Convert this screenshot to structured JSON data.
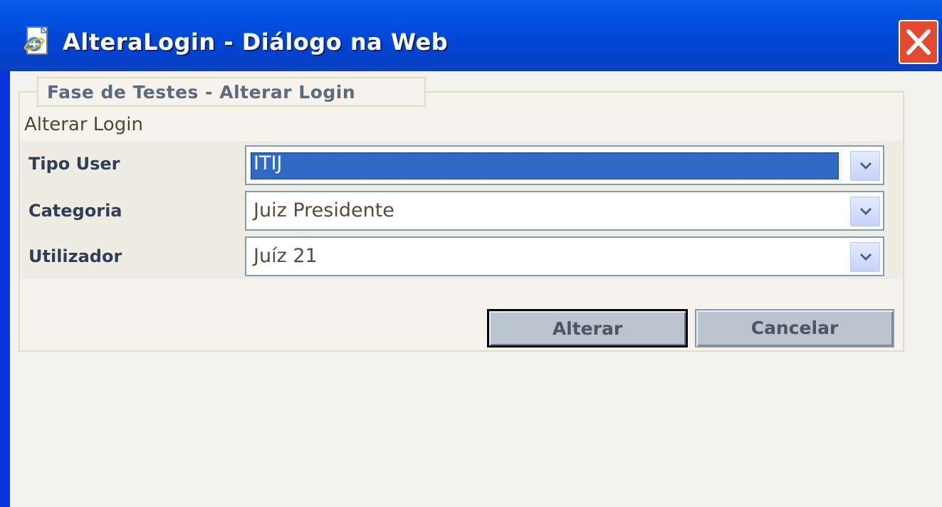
{
  "window": {
    "title": "AlteraLogin - Diálogo na Web",
    "icons": {
      "app": "ie-page-icon",
      "close": "close-icon"
    }
  },
  "fieldset": {
    "legend": "Fase de Testes - Alterar Login",
    "section_title": "Alterar Login"
  },
  "form": {
    "fields": [
      {
        "label": "Tipo User",
        "value": "ITIJ",
        "selected": true
      },
      {
        "label": "Categoria",
        "value": "Juiz Presidente",
        "selected": false
      },
      {
        "label": "Utilizador",
        "value": "Juíz 21",
        "selected": false
      }
    ]
  },
  "buttons": {
    "submit_label": "Alterar",
    "cancel_label": "Cancelar"
  },
  "colors": {
    "titlebar": "#0054e3",
    "close": "#e2492f",
    "selection": "#316ac5",
    "panel": "#f5f3ec"
  }
}
